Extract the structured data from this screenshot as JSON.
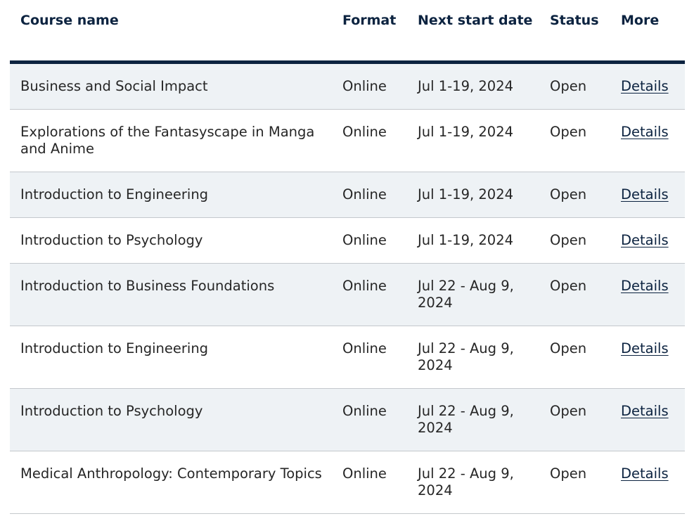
{
  "table": {
    "headers": {
      "course_name": "Course name",
      "format": "Format",
      "next_start_date": "Next start date",
      "status": "Status",
      "more": "More"
    },
    "rows": [
      {
        "course": "Business and Social Impact",
        "format": "Online",
        "date": "Jul 1-19, 2024",
        "status": "Open",
        "link": "Details"
      },
      {
        "course": "Explorations of the Fantasyscape in Manga and Anime",
        "format": "Online",
        "date": "Jul 1-19, 2024",
        "status": "Open",
        "link": "Details"
      },
      {
        "course": "Introduction to Engineering",
        "format": "Online",
        "date": "Jul 1-19, 2024",
        "status": "Open",
        "link": "Details"
      },
      {
        "course": "Introduction to Psychology",
        "format": "Online",
        "date": "Jul 1-19, 2024",
        "status": "Open",
        "link": "Details"
      },
      {
        "course": "Introduction to Business Foundations",
        "format": "Online",
        "date": "Jul 22 - Aug 9, 2024",
        "status": "Open",
        "link": "Details"
      },
      {
        "course": "Introduction to Engineering",
        "format": "Online",
        "date": "Jul 22 - Aug 9, 2024",
        "status": "Open",
        "link": "Details"
      },
      {
        "course": "Introduction to Psychology",
        "format": "Online",
        "date": "Jul 22 - Aug 9, 2024",
        "status": "Open",
        "link": "Details"
      },
      {
        "course": "Medical Anthropology: Contemporary Topics",
        "format": "Online",
        "date": "Jul 22 - Aug 9, 2024",
        "status": "Open",
        "link": "Details"
      }
    ]
  },
  "colors": {
    "header_text": "#0c2340",
    "header_rule": "#0c2340",
    "row_stripe": "#eef2f5",
    "row_border": "#c4c8cc",
    "link": "#0c2340"
  }
}
